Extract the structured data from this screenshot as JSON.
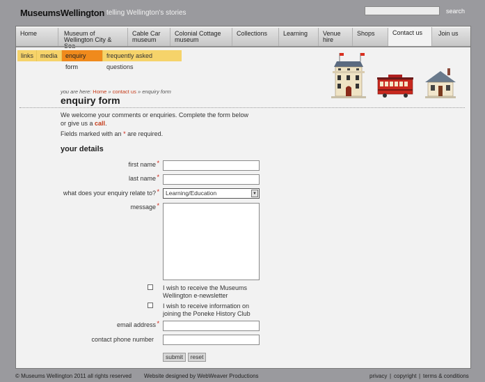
{
  "header": {
    "logo": "MuseumsWellington",
    "tagline": "telling Wellington's stories",
    "search_label": "search",
    "search_value": ""
  },
  "nav": {
    "tabs": [
      {
        "label": "Home"
      },
      {
        "label": "Museum of Wellington City & Sea"
      },
      {
        "label": "Cable Car museum"
      },
      {
        "label": "Colonial Cottage museum"
      },
      {
        "label": "Collections"
      },
      {
        "label": "Learning"
      },
      {
        "label": "Venue hire"
      },
      {
        "label": "Shops"
      },
      {
        "label": "Contact us"
      },
      {
        "label": "Join us"
      }
    ],
    "active_tab": "Contact us"
  },
  "subnav": {
    "items": [
      {
        "label": "links"
      },
      {
        "label": "media"
      },
      {
        "label": "enquiry form"
      },
      {
        "label": "frequently asked questions"
      }
    ],
    "active": "enquiry form"
  },
  "breadcrumb": {
    "prefix": "you are here:",
    "home": "Home",
    "sep1": "»",
    "contact": "contact us",
    "sep2": "»",
    "current": "enquiry form"
  },
  "page_title": "enquiry form",
  "intro": {
    "text_before": "We welcome your comments or enquiries. Complete the form below or give us a",
    "call_link": "call",
    "text_after": "."
  },
  "required_note": {
    "before": "Fields marked with an",
    "star": "*",
    "after": "are required."
  },
  "section_title": "your details",
  "form": {
    "first_name_label": "first name",
    "last_name_label": "last name",
    "enquiry_label": "what does your enquiry relate to?",
    "enquiry_value": "Learning/Education",
    "message_label": "message",
    "newsletter_label": "I wish to receive the Museums Wellington e-newsletter",
    "history_club_label": "I wish to receive information on joining the Poneke History Club",
    "email_label": "email address",
    "phone_label": "contact phone number",
    "submit_label": "submit",
    "reset_label": "reset",
    "required_star": "*"
  },
  "footer": {
    "copyright": "© Museums Wellington 2011 all rights reserved",
    "designer": "Website designed by WebWeaver Productions",
    "links": [
      "privacy",
      "copyright",
      "terms & conditions"
    ],
    "separator": "|"
  },
  "colors": {
    "background": "#9a9a9e",
    "panel": "#f2f2f2",
    "subnav": "#f6d36a",
    "subnav_active": "#f08a1c",
    "link_accent": "#c43a18"
  }
}
